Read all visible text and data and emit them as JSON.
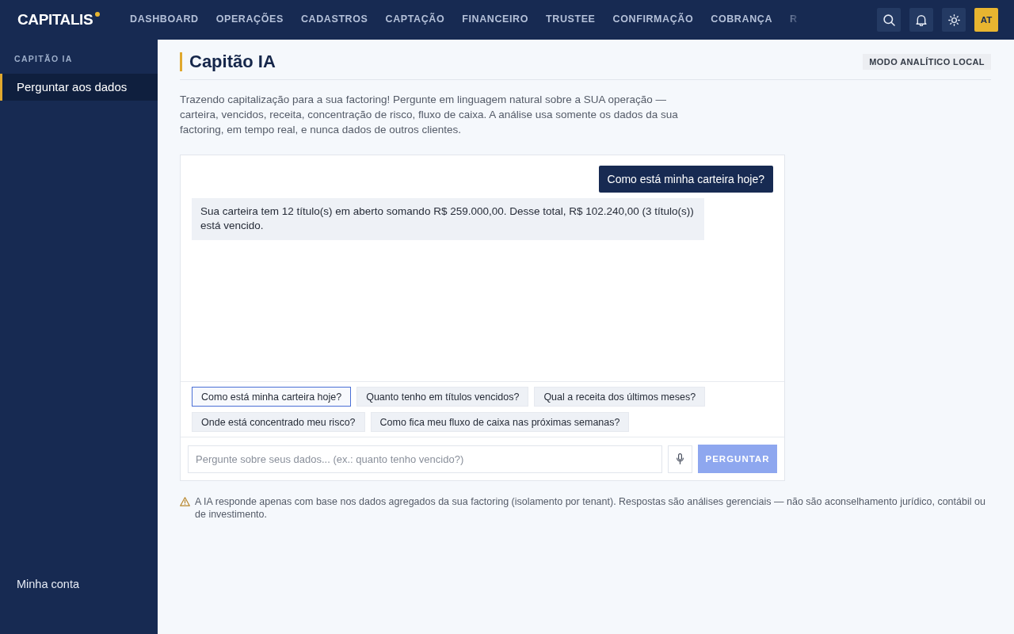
{
  "topbar": {
    "logo": "CAPITALIS",
    "nav": [
      {
        "label": "DASHBOARD",
        "selected": false
      },
      {
        "label": "OPERAÇÕES",
        "selected": false
      },
      {
        "label": "CADASTROS",
        "selected": false
      },
      {
        "label": "CAPTAÇÃO",
        "selected": false
      },
      {
        "label": "FINANCEIRO",
        "selected": false
      },
      {
        "label": "TRUSTEE",
        "selected": false
      },
      {
        "label": "CONFIRMAÇÃO",
        "selected": false
      },
      {
        "label": "COBRANÇA",
        "selected": false
      },
      {
        "label": "R",
        "selected": false
      }
    ],
    "avatar": "AT"
  },
  "sidebar": {
    "section": "CAPITÃO IA",
    "items": [
      {
        "label": "Perguntar aos dados",
        "selected": true
      }
    ],
    "footer": "Minha conta"
  },
  "page": {
    "title": "Capitão IA",
    "badge": "MODO ANALÍTICO LOCAL",
    "intro": "Trazendo capitalização para a sua factoring! Pergunte em linguagem natural sobre a SUA operação — carteira, vencidos, receita, concentração de risco, fluxo de caixa. A análise usa somente os dados da sua factoring, em tempo real, e nunca dados de outros clientes."
  },
  "chat": {
    "messages": [
      {
        "kind": "user",
        "text": "Como está minha carteira hoje?"
      },
      {
        "kind": "assistant",
        "text": "Sua carteira tem 12 título(s) em aberto somando R$ 259.000,00. Desse total, R$ 102.240,00 (3 título(s)) está vencido."
      }
    ],
    "suggestions": [
      {
        "label": "Como está minha carteira hoje?",
        "selected": true
      },
      {
        "label": "Quanto tenho em títulos vencidos?",
        "selected": false
      },
      {
        "label": "Qual a receita dos últimos meses?",
        "selected": false
      },
      {
        "label": "Onde está concentrado meu risco?",
        "selected": false
      },
      {
        "label": "Como fica meu fluxo de caixa nas próximas semanas?",
        "selected": false
      }
    ],
    "input": {
      "placeholder": "Pergunte sobre seus dados... (ex.: quanto tenho vencido?)"
    },
    "ask_button": {
      "label": "PERGUNTAR",
      "disabled": true
    }
  },
  "disclaimer": "A IA responde apenas com base nos dados agregados da sua factoring (isolamento por tenant). Respostas são análises gerenciais — não são aconselhamento jurídico, contábil ou de investimento."
}
